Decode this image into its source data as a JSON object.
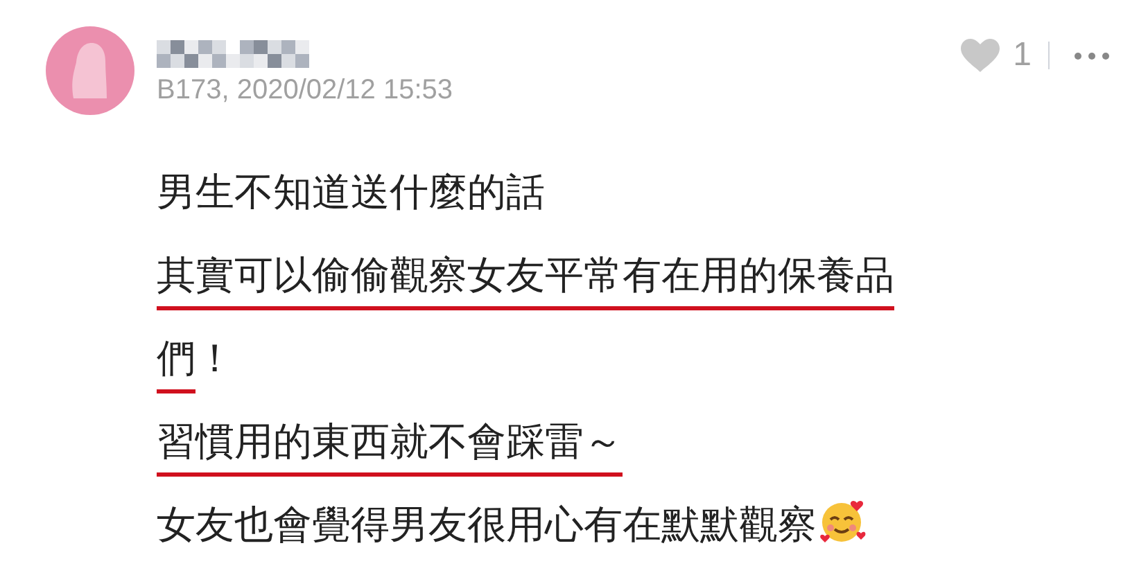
{
  "comment": {
    "meta": "B173, 2020/02/12 15:53",
    "likes": "1",
    "liked": false,
    "lines": [
      [
        {
          "text": "男生不知道送什麼的話",
          "underlined": false
        }
      ],
      [
        {
          "text": "其實可以偷偷觀察女友平常有在用的保養品",
          "underlined": true
        }
      ],
      [
        {
          "text": "們",
          "underlined": true
        },
        {
          "text": "！",
          "underlined": false
        }
      ],
      [
        {
          "text": "習慣用的東西就不會踩雷～",
          "underlined": true
        }
      ],
      [
        {
          "text": "女友也會覺得男友很用心有在默默觀察",
          "underlined": false
        }
      ]
    ]
  }
}
